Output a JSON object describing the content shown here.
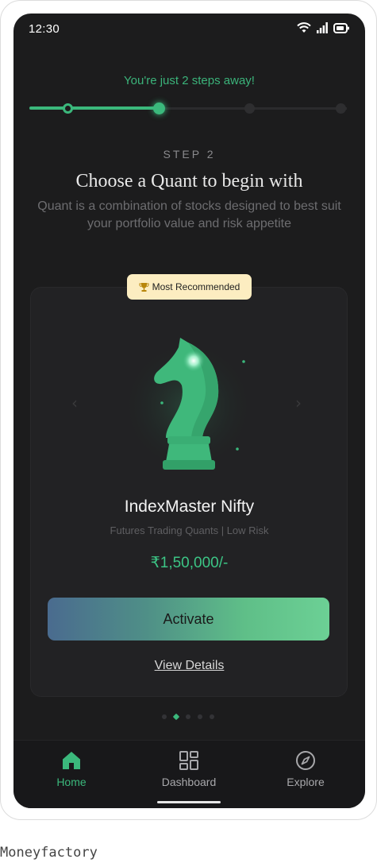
{
  "status_bar": {
    "time": "12:30"
  },
  "onboarding": {
    "steps_text": "You're just 2 steps away!",
    "progress": {
      "total_steps": 4,
      "current_step": 2
    },
    "step_label": "STEP 2",
    "title": "Choose a Quant to begin with",
    "subtitle": "Quant is a combination of stocks designed to best suit your portfolio value and risk appetite"
  },
  "card": {
    "badge_icon": "trophy-icon",
    "badge_label": "Most Recommended",
    "quant_name": "IndexMaster Nifty",
    "quant_meta": "Futures Trading Quants | Low Risk",
    "price": "₹1,50,000/-",
    "activate_label": "Activate",
    "view_details_label": "View Details",
    "carousel": {
      "count": 5,
      "active_index": 1
    }
  },
  "nav": {
    "items": [
      {
        "label": "Home",
        "icon": "home-icon",
        "active": true
      },
      {
        "label": "Dashboard",
        "icon": "dashboard-icon",
        "active": false
      },
      {
        "label": "Explore",
        "icon": "compass-icon",
        "active": false
      }
    ]
  },
  "caption": "Moneyfactory",
  "colors": {
    "accent": "#3bb87c",
    "background": "#1c1c1d",
    "badge": "#fcedc1"
  }
}
